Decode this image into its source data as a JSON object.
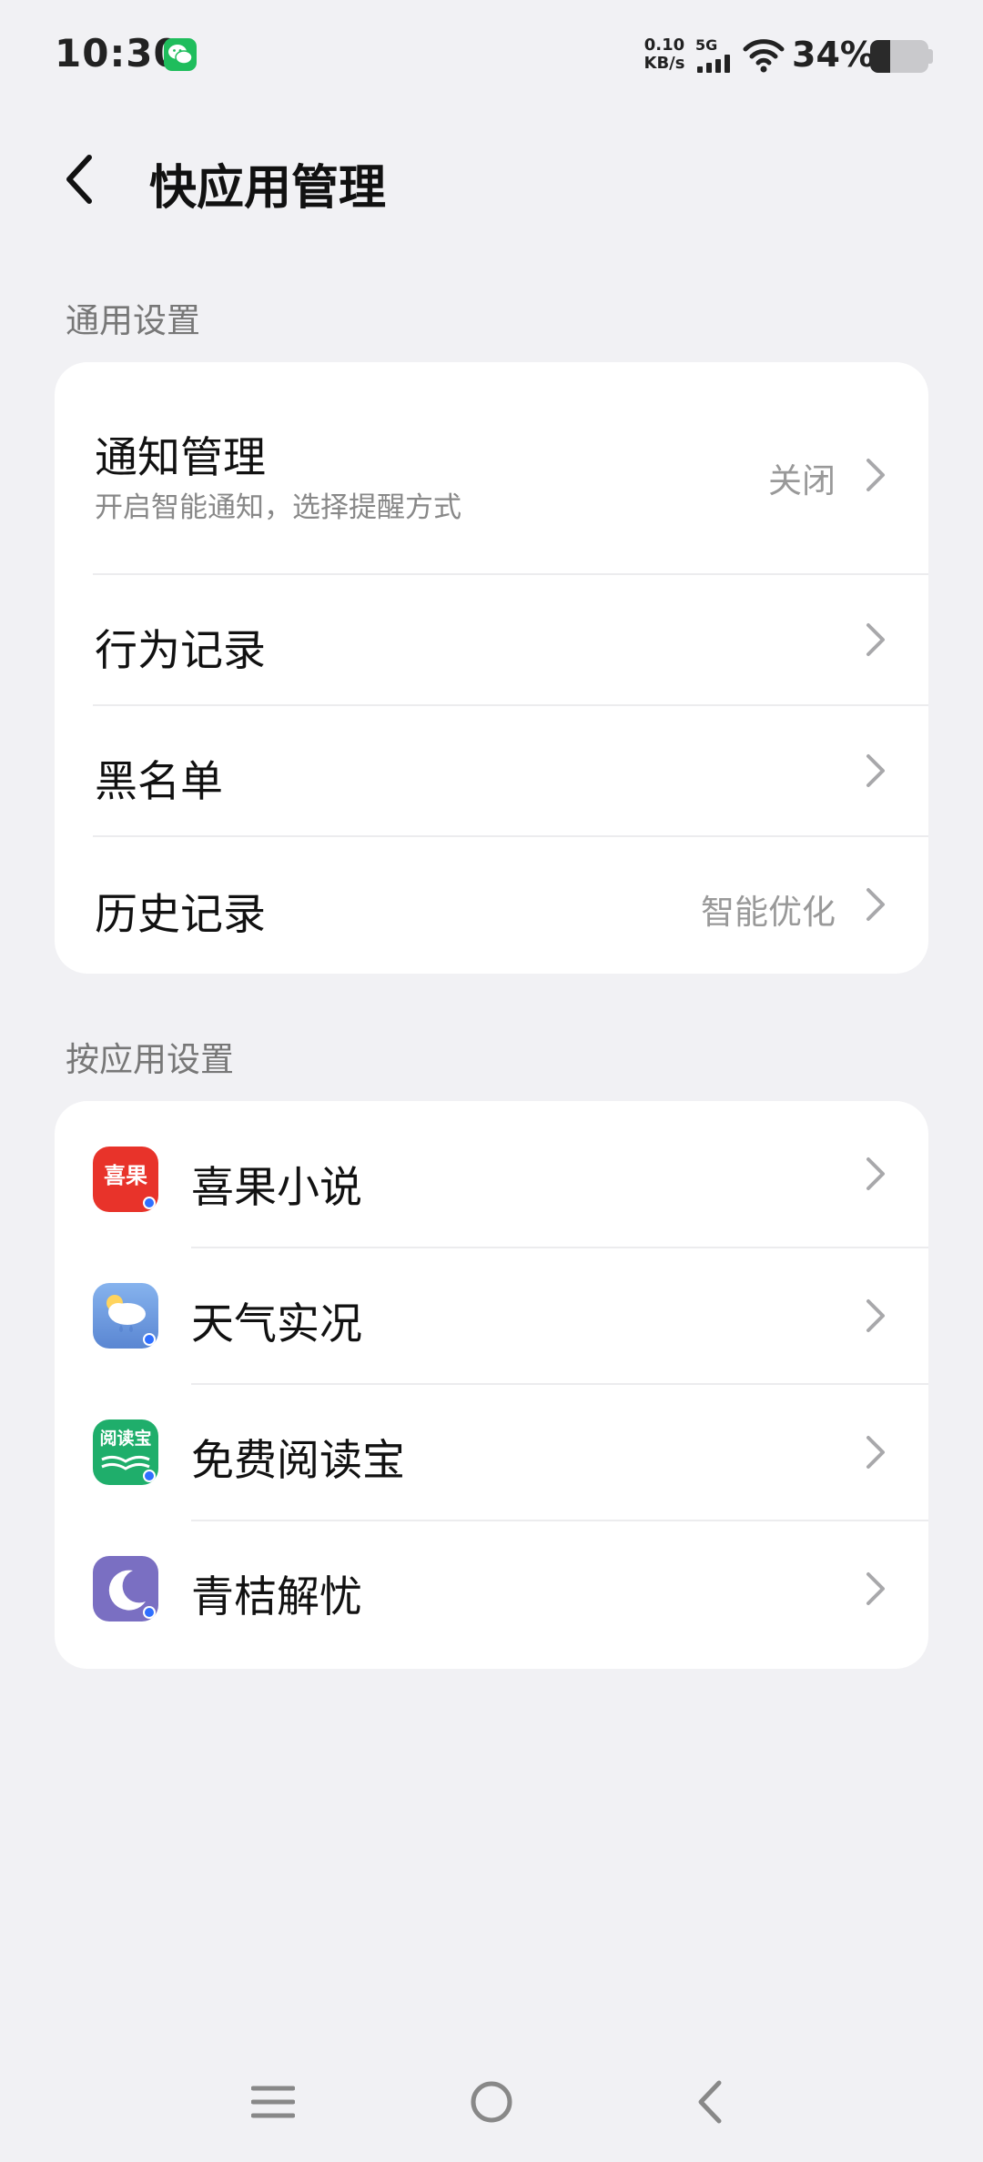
{
  "status_bar": {
    "time": "10:30",
    "net_speed_value": "0.10",
    "net_speed_unit": "KB/s",
    "network_type": "5G",
    "battery_percent_text": "34%",
    "battery_level": 0.34
  },
  "header": {
    "title": "快应用管理"
  },
  "general_section": {
    "label": "通用设置",
    "items": [
      {
        "title": "通知管理",
        "subtitle": "开启智能通知，选择提醒方式",
        "value": "关闭"
      },
      {
        "title": "行为记录",
        "value": ""
      },
      {
        "title": "黑名单",
        "value": ""
      },
      {
        "title": "历史记录",
        "value": "智能优化"
      }
    ]
  },
  "apps_section": {
    "label": "按应用设置",
    "apps": [
      {
        "name": "喜果小说",
        "icon": "xiguo-novel-icon",
        "icon_text": "喜果",
        "color": "#e8332a"
      },
      {
        "name": "天气实况",
        "icon": "weather-icon",
        "color": "#6f9ee0"
      },
      {
        "name": "免费阅读宝",
        "icon": "yuedubao-icon",
        "icon_text": "阅读宝",
        "color": "#1fae6b"
      },
      {
        "name": "青桔解忧",
        "icon": "moon-sleep-icon",
        "color": "#7a6fc2"
      }
    ]
  },
  "nav_bar": {
    "buttons": [
      "menu",
      "home",
      "back"
    ]
  }
}
